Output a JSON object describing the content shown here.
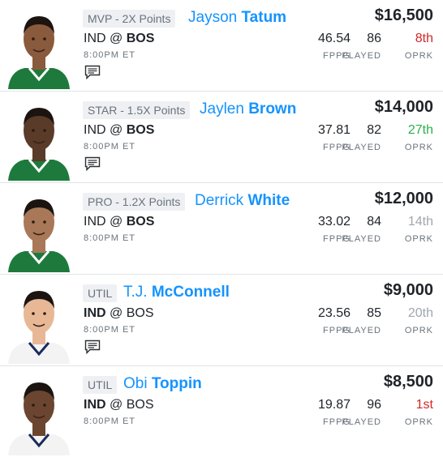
{
  "labels": {
    "fppg": "FPPG",
    "played": "PLAYED",
    "oprk": "OPRK"
  },
  "players": [
    {
      "badge": "MVP - 2X Points",
      "first": "Jayson",
      "last": "Tatum",
      "team_a": "IND",
      "at": "@",
      "team_b": "BOS",
      "bold_team": "b",
      "time": "8:00PM ET",
      "salary": "$16,500",
      "fppg": "46.54",
      "played": "86",
      "oprk": "8th",
      "oprk_color": "#d12828",
      "has_notes": true,
      "jersey": "#1e7a3c",
      "trim": "#ffffff",
      "skin": "#8a5a3c"
    },
    {
      "badge": "STAR - 1.5X Points",
      "first": "Jaylen",
      "last": "Brown",
      "team_a": "IND",
      "at": "@",
      "team_b": "BOS",
      "bold_team": "b",
      "time": "8:00PM ET",
      "salary": "$14,000",
      "fppg": "37.81",
      "played": "82",
      "oprk": "27th",
      "oprk_color": "#2bb04a",
      "has_notes": true,
      "jersey": "#1e7a3c",
      "trim": "#ffffff",
      "skin": "#5a3a28"
    },
    {
      "badge": "PRO - 1.2X Points",
      "first": "Derrick",
      "last": "White",
      "team_a": "IND",
      "at": "@",
      "team_b": "BOS",
      "bold_team": "b",
      "time": "8:00PM ET",
      "salary": "$12,000",
      "fppg": "33.02",
      "played": "84",
      "oprk": "14th",
      "oprk_color": "#a0a6ad",
      "has_notes": false,
      "jersey": "#1e7a3c",
      "trim": "#ffffff",
      "skin": "#a87858"
    },
    {
      "badge": "UTIL",
      "first": "T.J.",
      "last": "McConnell",
      "team_a": "IND",
      "at": "@",
      "team_b": "BOS",
      "bold_team": "a",
      "time": "8:00PM ET",
      "salary": "$9,000",
      "fppg": "23.56",
      "played": "85",
      "oprk": "20th",
      "oprk_color": "#a0a6ad",
      "has_notes": true,
      "jersey": "#f3f3f3",
      "trim": "#1a2c5b",
      "skin": "#e8b896"
    },
    {
      "badge": "UTIL",
      "first": "Obi",
      "last": "Toppin",
      "team_a": "IND",
      "at": "@",
      "team_b": "BOS",
      "bold_team": "a",
      "time": "8:00PM ET",
      "salary": "$8,500",
      "fppg": "19.87",
      "played": "96",
      "oprk": "1st",
      "oprk_color": "#d12828",
      "has_notes": false,
      "jersey": "#f3f3f3",
      "trim": "#1a2c5b",
      "skin": "#6b4530"
    }
  ]
}
